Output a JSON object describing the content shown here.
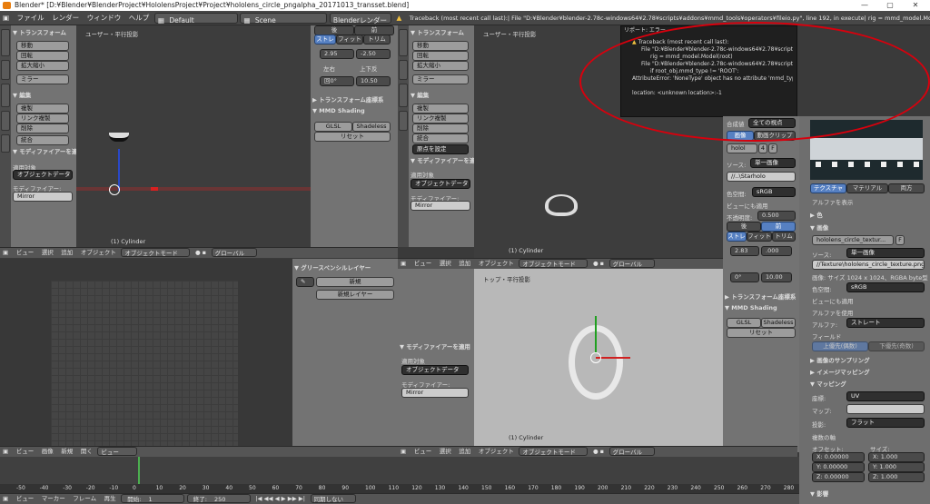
{
  "titlebar": {
    "title": "Blender* [D:¥Blender¥BlenderProject¥HololensProject¥Project¥hololens_circle_pngalpha_20171013_transset.blend]",
    "min": "—",
    "max": "▢",
    "close": "✕"
  },
  "menubar": {
    "items": [
      "ファイル",
      "レンダー",
      "ウィンドウ",
      "ヘルプ"
    ],
    "layout": "Default",
    "scene": "Scene",
    "engine": "Blenderレンダー",
    "traceback": "Traceback (most recent call last):|  File \"D:¥Blender¥blender-2.78c-windows64¥2.78¥scripts¥addons¥mmd_tools¥operators¥fileio.py\", line 192, in execute|    rig = mmd_model.Model(root)|  File \"D:¥Blender¥blender-2.78c-windows64¥2.78\""
  },
  "error": {
    "title": "リポート: エラー",
    "lines": [
      "Traceback (most recent call last):",
      "File \"D:¥Blender¥blender-2.78c-windows64¥2.78¥scripts¥addons¥mmd_tools¥operators¥fileio.py\", line 192, in execute",
      "rig = mmd_model.Model(root)",
      "File \"D:¥Blender¥blender-2.78c-windows64¥2.78¥scripts¥addons¥mmd_tools¥core¥model.py\", line 60, in __init__",
      "if root_obj.mmd_type != 'ROOT':",
      "AttributeError: 'NoneType' object has no attribute 'mmd_type'",
      "",
      "location: <unknown location>:-1"
    ]
  },
  "toolshelf_left": {
    "transform": "▼ トランスフォーム",
    "move": "移動",
    "rotate": "回転",
    "scale": "拡大縮小",
    "mirror": "ミラー",
    "edit": "▼ 編集",
    "duplicate": "複製",
    "link_dup": "リンク複製",
    "delete": "削除",
    "join": "統合",
    "modifier": "▼ モディファイアーを適用",
    "apply_to": "適用対象",
    "object_data": "オブジェクトデータ",
    "modifier_label": "モディファイアー:",
    "mirror_mod": "Mirror",
    "tabs": [
      "ツール",
      "作成",
      "リレーション",
      "アニメーション",
      "物理演算",
      "グリースペンシル",
      "mmd"
    ]
  },
  "view1": {
    "label": "ユーザー・平行投影",
    "object": "(1) Cylinder"
  },
  "props_mid": {
    "front": "後",
    "back": "前",
    "stretch": "ストレ",
    "fit": "フィット",
    "trim": "トリム",
    "v1": "2.95",
    "v2": "-2.50",
    "left_right": "左右",
    "up_down": "上下反",
    "v3": "回0°",
    "v4": "10.50",
    "transform_coord": "▶ トランスフォーム座標系",
    "mmd": "▼ MMD Shading",
    "glsl": "GLSL",
    "shadeless": "Shadeless",
    "reset": "リセット"
  },
  "view1_header": {
    "items": [
      "ビュー",
      "選択",
      "追加",
      "オブジェクト"
    ],
    "mode": "オブジェクトモード",
    "global": "グローバル"
  },
  "view2": {
    "label": "ユーザー・平行投影",
    "object": "(1) Cylinder"
  },
  "toolshelf_mid": {
    "transform": "▼ トランスフォーム",
    "move": "移動",
    "rotate": "回転",
    "scale": "拡大縮小",
    "mirror": "ミラー",
    "edit": "▼ 編集",
    "duplicate": "複製",
    "link_dup": "リンク複製",
    "delete": "削除",
    "join": "統合",
    "origin": "原点を設定",
    "modifier": "▼ モディファイアーを適用",
    "apply_to": "適用対象",
    "object_data": "オブジェクトデータ",
    "modifier_label": "モディファイアー:",
    "mirror_mod": "Mirror"
  },
  "props_right": {
    "blend": "合成値",
    "blend_val": "全ての視点",
    "image": "画像",
    "clip": "動画クリップ",
    "holo": "holol",
    "four": "4",
    "f": "F",
    "source": "ソース:",
    "single": "単一画像",
    "path": "//..\\Starholo",
    "colorspace": "色空間:",
    "srgb": "sRGB",
    "view_apply": "ビューにも適用",
    "opacity": "不透明度:",
    "opacity_val": "0.500",
    "front": "後",
    "back": "前",
    "stretch": "ストレ",
    "fit": "フィット",
    "trim": "トリム",
    "v1": "2.83",
    "v2": "0°",
    "v3": "10.00",
    "v4": ".000",
    "transform_coord": "▶ トランスフォーム座標系",
    "mmd": "▼ MMD Shading",
    "glsl": "GLSL",
    "shadeless": "Shadeless",
    "reset": "リセット"
  },
  "texture_panel": {
    "tabs": [
      "テクスチャ",
      "マテリアル",
      "両方"
    ],
    "alpha_show": "アルファを表示",
    "color": "▶ 色",
    "image_hdr": "▼ 画像",
    "image_name": "hololens_circle_textur...",
    "f": "F",
    "source": "ソース:",
    "single": "単一画像",
    "file": "//Texture\\hololens_circle_texture.png",
    "size": "画像: サイズ 1024 x 1024、RGBA byte型",
    "colorspace": "色空間:",
    "srgb": "sRGB",
    "view_apply": "ビューにも適用",
    "use_alpha": "アルファを使用",
    "alpha": "アルファ:",
    "straight": "ストレート",
    "field": "フィールド",
    "upper": "上優先(偶数)",
    "lower": "下優先(奇数)",
    "sampling": "▶ 画像のサンプリング",
    "mapping_img": "▶ イメージマッピング",
    "mapping": "▼ マッピング",
    "coords": "座標:",
    "uv": "UV",
    "map": "マップ:",
    "projection": "投影:",
    "flat": "フラット",
    "multi": "複数の軸",
    "offset": "オフセット:",
    "size_lbl": "サイズ:",
    "x": "X:",
    "y": "Y:",
    "z": "Z:",
    "zero": "0.00000",
    "one": "1.000",
    "influence": "▼ 影響"
  },
  "grease": {
    "header": "▼ グリースペンシルレイヤー",
    "new": "新規",
    "new_layer": "新規レイヤー"
  },
  "view3": {
    "label": "トップ・平行投影",
    "object": "(1) Cylinder"
  },
  "view2_header": {
    "items": [
      "ビュー",
      "選択",
      "追加",
      "オブジェクト"
    ],
    "mode": "オブジェクトモード",
    "global": "グローバル"
  },
  "view3_header": {
    "items": [
      "ビュー",
      "選択",
      "追加",
      "オブジェクト"
    ],
    "mode": "オブジェクトモード",
    "global": "グローバル"
  },
  "uv_header": {
    "items": [
      "ビュー",
      "画像"
    ],
    "new": "新規",
    "open": "開く",
    "view": "ビュー"
  },
  "timeline": {
    "ticks": [
      "-50",
      "-40",
      "-30",
      "-20",
      "-10",
      "0",
      "10",
      "20",
      "30",
      "40",
      "50",
      "60",
      "70",
      "80",
      "90",
      "100",
      "110",
      "120",
      "130",
      "140",
      "150",
      "160",
      "170",
      "180",
      "190",
      "200",
      "210",
      "220",
      "230",
      "240",
      "250",
      "260",
      "270",
      "280"
    ],
    "items": [
      "ビュー",
      "マーカー",
      "フレーム",
      "再生"
    ],
    "start": "開始:",
    "start_val": "1",
    "end": "終了:",
    "end_val": "250",
    "sync": "同期しない"
  }
}
